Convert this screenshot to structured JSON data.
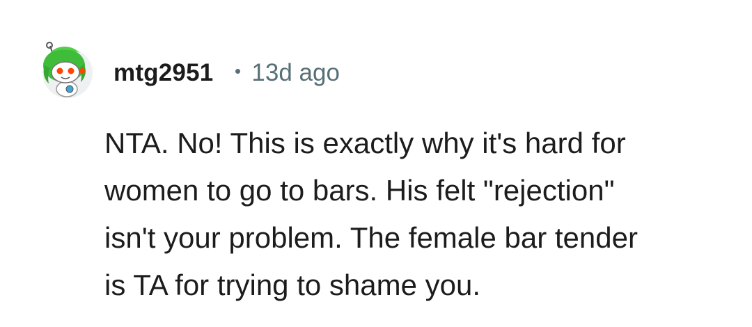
{
  "comment": {
    "username": "mtg2951",
    "separator": "•",
    "timestamp": "13d ago",
    "body": "NTA. No! This is exactly why it's hard for\nwomen to go to bars. His felt \"rejection\"\nisn't your problem. The female bar tender\nis TA for trying to shame you.",
    "avatar": {
      "icon": "snoo-avatar-icon",
      "background": "#eef0f1",
      "hair_color": "#3fbd3a",
      "eye_color": "#ff4500"
    }
  },
  "colors": {
    "text_primary": "#1c1c1c",
    "text_secondary": "#576f76",
    "page_background": "#ffffff"
  }
}
